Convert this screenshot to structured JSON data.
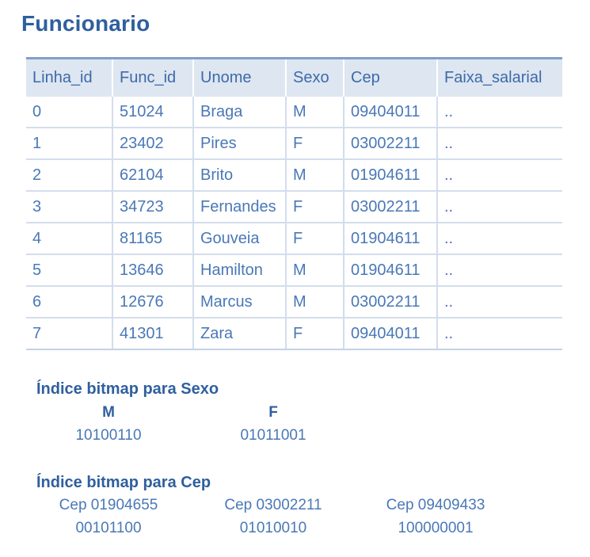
{
  "title": "Funcionario",
  "table": {
    "headers": [
      "Linha_id",
      "Func_id",
      "Unome",
      "Sexo",
      "Cep",
      "Faixa_salarial"
    ],
    "rows": [
      [
        "0",
        "51024",
        "Braga",
        "M",
        "09404011",
        ".."
      ],
      [
        "1",
        "23402",
        "Pires",
        "F",
        "03002211",
        ".."
      ],
      [
        "2",
        "62104",
        "Brito",
        "M",
        "01904611",
        ".."
      ],
      [
        "3",
        "34723",
        "Fernandes",
        "F",
        "03002211",
        ".."
      ],
      [
        "4",
        "81165",
        "Gouveia",
        "F",
        "01904611",
        ".."
      ],
      [
        "5",
        "13646",
        "Hamilton",
        "M",
        "01904611",
        ".."
      ],
      [
        "6",
        "12676",
        "Marcus",
        "M",
        "03002211",
        ".."
      ],
      [
        "7",
        "41301",
        "Zara",
        "F",
        "09404011",
        ".."
      ]
    ]
  },
  "bitmap_sexo": {
    "title": "Índice bitmap para Sexo",
    "entries": [
      {
        "label": "M",
        "bits": "10100110"
      },
      {
        "label": "F",
        "bits": "01011001"
      }
    ]
  },
  "bitmap_cep": {
    "title": "Índice bitmap para Cep",
    "entries": [
      {
        "label": "Cep 01904655",
        "bits": "00101100"
      },
      {
        "label": "Cep 03002211",
        "bits": "01010010"
      },
      {
        "label": "Cep 09409433",
        "bits": "100000001"
      }
    ]
  }
}
